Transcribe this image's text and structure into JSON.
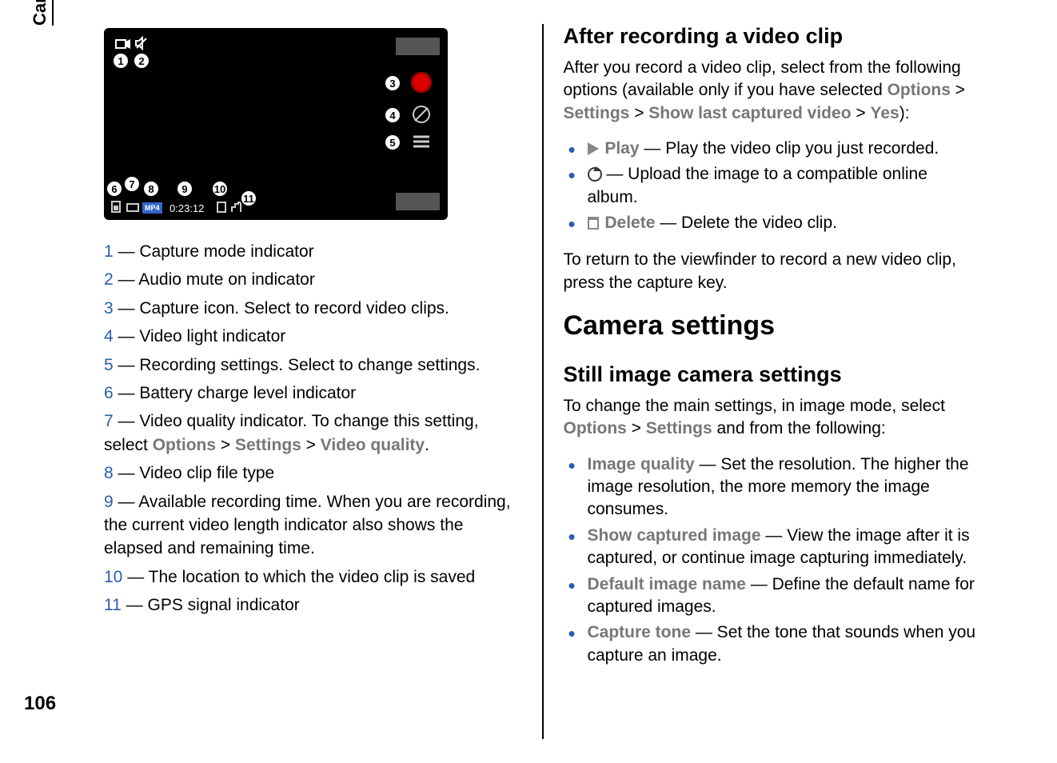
{
  "sideTab": "Camera",
  "pageNumber": "106",
  "viewfinder": {
    "time": "0:23:12",
    "fileType": "MP4"
  },
  "legend": [
    {
      "n": "1",
      "text": " — Capture mode indicator"
    },
    {
      "n": "2",
      "text": " — Audio mute on indicator"
    },
    {
      "n": "3",
      "text": " — Capture icon. Select to record video clips."
    },
    {
      "n": "4",
      "text": " — Video light indicator"
    },
    {
      "n": "5",
      "text": " — Recording settings. Select to change settings."
    },
    {
      "n": "6",
      "text": " — Battery charge level indicator"
    },
    {
      "n": "7",
      "text": " — Video quality indicator. To change this setting, select ",
      "trail": true
    },
    {
      "n": "8",
      "text": " — Video clip file type"
    },
    {
      "n": "9",
      "text": " — Available recording time. When you are recording, the current video length indicator also shows the elapsed and remaining time."
    },
    {
      "n": "10",
      "text": " — The location to which the video clip is saved"
    },
    {
      "n": "11",
      "text": " — GPS signal indicator"
    }
  ],
  "legend7Path": {
    "a": "Options",
    "b": "Settings",
    "c": "Video quality"
  },
  "right": {
    "h_after": "After recording a video clip",
    "p_after": "After you record a video clip, select from the following options (available only if you have selected ",
    "path1": {
      "a": "Options",
      "b": "Settings",
      "c": "Show last captured video",
      "d": "Yes"
    },
    "p_after_tail": "):",
    "opts_after": [
      {
        "label": "Play",
        "text": " — Play the video clip you just recorded."
      },
      {
        "label": "",
        "text": " — Upload the image to a compatible online album."
      },
      {
        "label": "Delete",
        "text": " — Delete the video clip."
      }
    ],
    "p_return": "To return to the viewfinder to record a new video clip, press the capture key.",
    "h_settings": "Camera settings",
    "h_still": "Still image camera settings",
    "p_still": "To change the main settings, in image mode, select ",
    "path2": {
      "a": "Options",
      "b": "Settings"
    },
    "p_still_tail": " and from the following:",
    "opts_still": [
      {
        "label": "Image quality",
        "text": " — Set the resolution. The higher the image resolution, the more memory the image consumes."
      },
      {
        "label": "Show captured image",
        "text": " — View the image after it is captured, or continue image capturing immediately."
      },
      {
        "label": "Default image name",
        "text": " — Define the default name for captured images."
      },
      {
        "label": "Capture tone",
        "text": " — Set the tone that sounds when you capture an image."
      }
    ]
  },
  "gt": ">"
}
